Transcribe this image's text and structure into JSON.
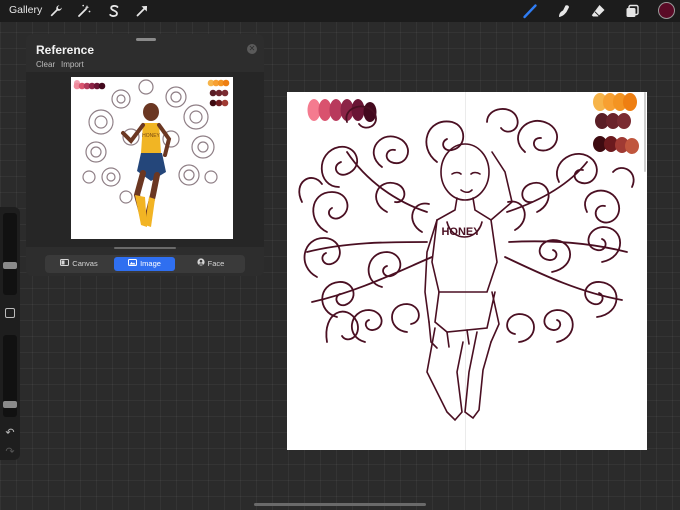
{
  "toolbar": {
    "gallery_label": "Gallery",
    "left_tools": [
      {
        "name": "actions-wrench-icon"
      },
      {
        "name": "adjustments-wand-icon"
      },
      {
        "name": "selection-s-icon"
      },
      {
        "name": "transform-arrow-icon"
      }
    ],
    "right_tools": [
      {
        "name": "brush-icon",
        "active": true
      },
      {
        "name": "smudge-icon"
      },
      {
        "name": "eraser-icon"
      },
      {
        "name": "layers-icon"
      }
    ],
    "current_color": "#5a0a26"
  },
  "sidebar": {
    "undo_icon": "undo-icon",
    "redo_icon": "redo-icon",
    "modify_icon": "modify-square-icon"
  },
  "reference_panel": {
    "title": "Reference",
    "actions": [
      "Clear",
      "Import"
    ],
    "modes": [
      {
        "label": "Canvas",
        "icon": "canvas-icon",
        "active": false
      },
      {
        "label": "Image",
        "icon": "image-icon",
        "active": true
      },
      {
        "label": "Face",
        "icon": "face-icon",
        "active": false
      }
    ],
    "image_text": "HONEY"
  },
  "canvas": {
    "shirt_text": "HONEY",
    "palette_top_left": [
      "#f47b8f",
      "#d9526e",
      "#b83a5c",
      "#8c2447",
      "#6a1535",
      "#43091e"
    ],
    "palette_top_right": [
      "#f6b44a",
      "#f7a032",
      "#f39422",
      "#ee7f12"
    ],
    "palette_mid_right": [
      "#5a1e26",
      "#6b232b",
      "#7a2b32"
    ],
    "palette_low_right": [
      "#3e0b11",
      "#6c1a1e",
      "#a03a33",
      "#c0563d"
    ],
    "line_color": "#4a0f22"
  }
}
